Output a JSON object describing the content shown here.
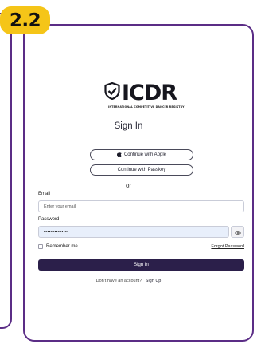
{
  "badge": {
    "label": "2.2"
  },
  "logo": {
    "text": "ICDR",
    "subtitle": "INTERNATIONAL COMPETITIVE DANCER REGISTRY"
  },
  "page": {
    "title": "Sign In"
  },
  "auth": {
    "apple_label": "Continue with Apple",
    "passkey_label": "Continue with Passkey",
    "or_label": "or"
  },
  "form": {
    "email_label": "Email",
    "email_placeholder": "Enter your email",
    "password_label": "Password",
    "password_value": "••••••••••••••",
    "remember_label": "Remember me",
    "forgot_label": "Forgot Password",
    "submit_label": "Sign In"
  },
  "footer": {
    "prompt": "Don't have an account?",
    "signup_label": "Sign Up"
  },
  "colors": {
    "frame": "#5b2d86",
    "badge": "#f5c518",
    "primary_button": "#2b1f4a",
    "password_fill": "#e8effb"
  },
  "icons": [
    "shield-check-icon",
    "apple-icon",
    "eye-icon"
  ]
}
